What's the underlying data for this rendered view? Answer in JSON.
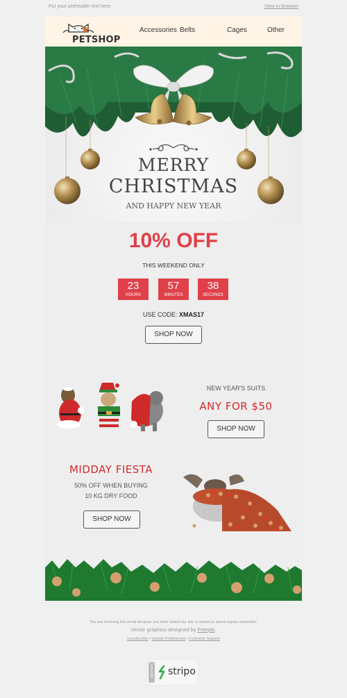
{
  "preheader": {
    "text": "Put your preheader text here",
    "view_in_browser": "View in browser"
  },
  "header": {
    "logo_text": "PETSHOP",
    "nav": [
      {
        "label": "Accessories"
      },
      {
        "label": "Belts"
      },
      {
        "label": "Cages"
      },
      {
        "label": "Other"
      }
    ]
  },
  "hero": {
    "title_line1": "MERRY",
    "title_line2": "CHRISTMAS",
    "subtitle": "AND HAPPY NEW YEAR"
  },
  "promo": {
    "discount": "10% OFF",
    "note": "THIS WEEKEND ONLY",
    "countdown": [
      {
        "value": "23",
        "label": "HOURS"
      },
      {
        "value": "57",
        "label": "MINUTES"
      },
      {
        "value": "38",
        "label": "SECONDS"
      }
    ],
    "code_label": "USE CODE:",
    "code": "XMAS17",
    "button": "SHOP NOW"
  },
  "suits": {
    "label": "NEW YEAR'S SUITS",
    "title": "ANY FOR $50",
    "button": "SHOP NOW"
  },
  "fiesta": {
    "title": "MIDDAY FIESTA",
    "line1": "50% OFF WHEN BUYING",
    "line2": "10 KG DRY FOOD",
    "button": "SHOP NOW"
  },
  "footer": {
    "line1": "You are receiving this email because you have visited our site or asked us about regular newsletter.",
    "line2_prefix": "Vector graphics designed by ",
    "line2_link": "Freepik",
    "line2_suffix": ".",
    "links": [
      {
        "label": "Unsubscribe"
      },
      {
        "label": "Update Preferences"
      },
      {
        "label": "Customer Support"
      }
    ],
    "separator": "•"
  },
  "badge": {
    "made_with": "MADE WITH",
    "brand": "stripo"
  },
  "colors": {
    "accent_red": "#e0404a",
    "title_red": "#d42a2a",
    "header_bg": "#fff4e6",
    "page_bg": "#f0f0f0",
    "stripo_green": "#2ea84a"
  }
}
